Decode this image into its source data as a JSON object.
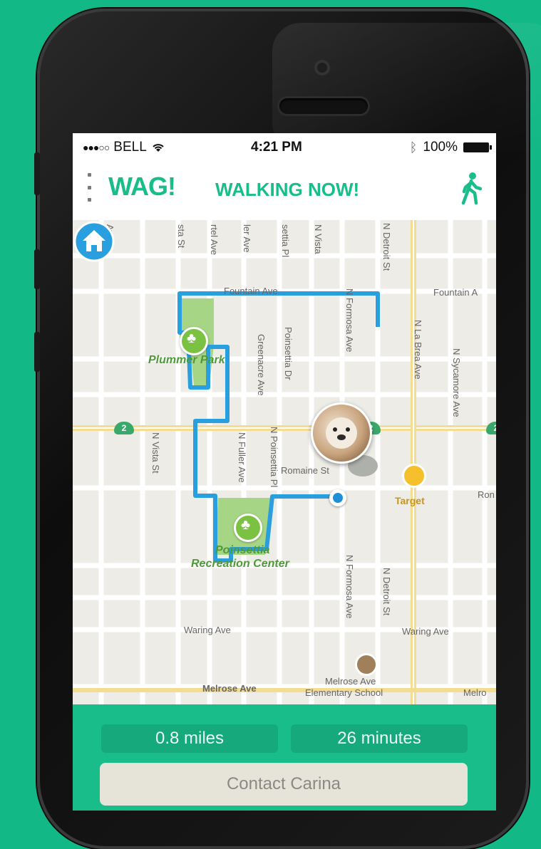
{
  "status_bar": {
    "carrier": "BELL",
    "time": "4:21 PM",
    "battery": "100%"
  },
  "header": {
    "logo": "WAG!",
    "title": "WALKING NOW!"
  },
  "map": {
    "streets": {
      "fountain_ave_1": "Fountain Ave",
      "fountain_ave_2": "Fountain A",
      "romaine_st": "Romaine St",
      "waring_ave_1": "Waring Ave",
      "waring_ave_2": "Waring Ave",
      "melrose_ave": "Melrose Ave",
      "melrose_right": "Melro",
      "greenacre_ave": "Greenacre Ave",
      "poinsettia_dr": "Poinsettia Dr",
      "n_fuller_ave": "N Fuller Ave",
      "n_poinsettia_pl": "N Poinsettia Pl",
      "n_vista_st": "N Vista St",
      "n_formosa_ave_top": "N Formosa Ave",
      "n_formosa_ave_bottom": "N Formosa Ave",
      "n_detroit_st_top": "N Detroit St",
      "n_detroit_st_bottom": "N Detroit St",
      "n_la_brea_ave": "N La Brea Ave",
      "n_sycamore_ave": "N Sycamore Ave",
      "ave_top_1": "Ave",
      "ave_top_2": "sta St",
      "ave_top_3": "rtel Ave",
      "ave_top_4": "ler Ave",
      "ave_top_5": "settia Pl",
      "ave_top_6": "N Vista",
      "ron_right": "Ron"
    },
    "places": {
      "plummer_park": "Plummer Park",
      "poinsettia_rec_1": "Poinsettia",
      "poinsettia_rec_2": "Recreation Center",
      "target": "Target",
      "melrose_school_1": "Melrose Ave",
      "melrose_school_2": "Elementary School"
    },
    "route_badges": [
      "2",
      "2",
      "2"
    ],
    "icons": [
      "home-icon",
      "tree-icon",
      "target-icon",
      "school-icon",
      "current-location-icon"
    ]
  },
  "stats": {
    "distance": "0.8 miles",
    "duration": "26 minutes"
  },
  "actions": {
    "contact": "Contact Carina"
  },
  "colors": {
    "brand": "#19bd8a",
    "route": "#2a9fe0",
    "background": "#12b886"
  }
}
